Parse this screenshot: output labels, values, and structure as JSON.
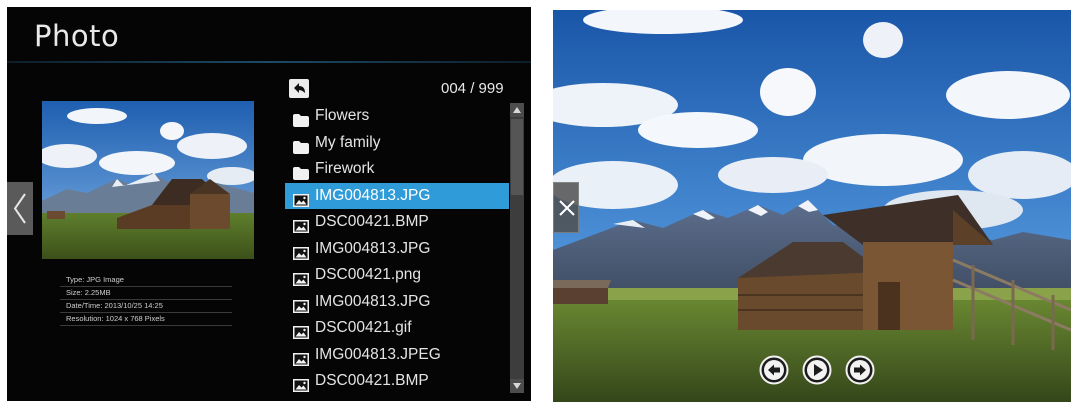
{
  "browser": {
    "title": "Photo",
    "page_counter": "004 / 999",
    "info": [
      "Type: JPG Image",
      "Size: 2.25MB",
      "Date/Time: 2013/10/25 14:25",
      "Resolution: 1024 x 768 Pixels"
    ],
    "items": [
      {
        "label": "Flowers",
        "kind": "folder",
        "selected": false
      },
      {
        "label": "My family",
        "kind": "folder",
        "selected": false
      },
      {
        "label": "Firework",
        "kind": "folder",
        "selected": false
      },
      {
        "label": "IMG004813.JPG",
        "kind": "image",
        "selected": true
      },
      {
        "label": "DSC00421.BMP",
        "kind": "image",
        "selected": false
      },
      {
        "label": "IMG004813.JPG",
        "kind": "image",
        "selected": false
      },
      {
        "label": "DSC00421.png",
        "kind": "image",
        "selected": false
      },
      {
        "label": "IMG004813.JPG",
        "kind": "image",
        "selected": false
      },
      {
        "label": "DSC00421.gif",
        "kind": "image",
        "selected": false
      },
      {
        "label": "IMG004813.JPEG",
        "kind": "image",
        "selected": false
      },
      {
        "label": "DSC00421.BMP",
        "kind": "image",
        "selected": false
      }
    ],
    "icons": {
      "back": "chevron-left-icon",
      "up": "return-arrow-icon",
      "folder": "folder-icon",
      "image": "image-file-icon"
    }
  },
  "viewer": {
    "icons": {
      "close": "close-icon",
      "previous": "arrow-left-circle-icon",
      "play": "play-circle-icon",
      "next": "arrow-right-circle-icon"
    }
  },
  "colors": {
    "panel_bg": "#050505",
    "selection": "#2f9bd9",
    "text": "#e4e4e4"
  }
}
